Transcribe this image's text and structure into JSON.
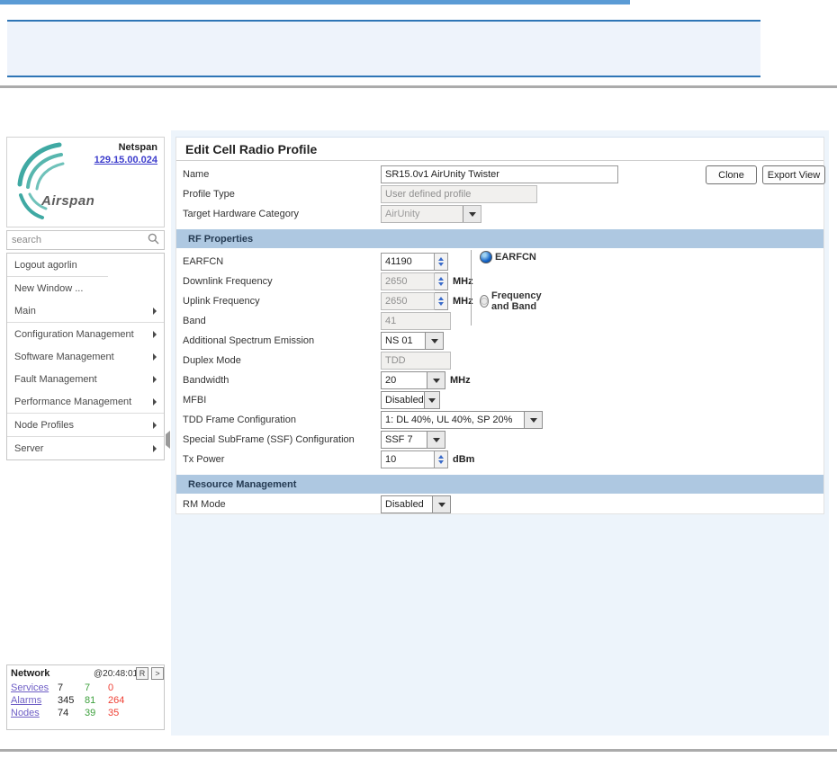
{
  "header": {
    "netspan_label": "Netspan",
    "version_link": "129.15.00.024",
    "logo_text": "Airspan"
  },
  "search": {
    "placeholder": "search"
  },
  "sidebar": {
    "items": [
      "Logout agorlin",
      "New Window ...",
      "Main",
      "Configuration Management",
      "Software Management",
      "Fault Management",
      "Performance Management",
      "Node Profiles",
      "Server"
    ]
  },
  "network_panel": {
    "title": "Network",
    "timestamp": "@20:48:01",
    "refresh_button": "R",
    "expand_button": ">",
    "rows": [
      {
        "label": "Services",
        "total": "7",
        "ok": "7",
        "bad": "0"
      },
      {
        "label": "Alarms",
        "total": "345",
        "ok": "81",
        "bad": "264"
      },
      {
        "label": "Nodes",
        "total": "74",
        "ok": "39",
        "bad": "35"
      }
    ]
  },
  "main": {
    "title": "Edit Cell Radio Profile",
    "clone_label": "Clone",
    "export_label": "Export View",
    "fields": {
      "name": {
        "label": "Name",
        "value": "SR15.0v1 AirUnity Twister"
      },
      "profile_type": {
        "label": "Profile Type",
        "value": "User defined profile"
      },
      "target_hw": {
        "label": "Target Hardware Category",
        "value": "AirUnity"
      }
    },
    "rf": {
      "section_title": "RF Properties",
      "earfcn": {
        "label": "EARFCN",
        "value": "41190"
      },
      "radio_earfcn_label": "EARFCN",
      "radio_freq_band_label": "Frequency and Band",
      "downlink": {
        "label": "Downlink Frequency",
        "value": "2650",
        "unit": "MHz"
      },
      "uplink": {
        "label": "Uplink Frequency",
        "value": "2650",
        "unit": "MHz"
      },
      "band": {
        "label": "Band",
        "value": "41"
      },
      "ase": {
        "label": "Additional Spectrum Emission",
        "value": "NS 01"
      },
      "duplex": {
        "label": "Duplex Mode",
        "value": "TDD"
      },
      "bandwidth": {
        "label": "Bandwidth",
        "value": "20",
        "unit": "MHz"
      },
      "mfbi": {
        "label": "MFBI",
        "value": "Disabled"
      },
      "tdd_frame": {
        "label": "TDD Frame Configuration",
        "value": "1: DL 40%, UL 40%, SP 20%"
      },
      "ssf": {
        "label": "Special SubFrame (SSF) Configuration",
        "value": "SSF 7"
      },
      "tx_power": {
        "label": "Tx Power",
        "value": "10",
        "unit": "dBm"
      }
    },
    "rm": {
      "section_title": "Resource Management",
      "rm_mode": {
        "label": "RM Mode",
        "value": "Disabled"
      }
    }
  },
  "colors": {
    "accent_blue": "#5b9bd5",
    "notice_border_blue": "#2e75b6",
    "section_header_blue": "#aec8e1",
    "panel_background": "#edf4fb",
    "link_blue": "#3c3ccc",
    "link_purple": "#6f5fc6",
    "status_green": "#3da03d",
    "status_red": "#ef4136",
    "spinner_arrow_blue": "#3a6bc9"
  }
}
